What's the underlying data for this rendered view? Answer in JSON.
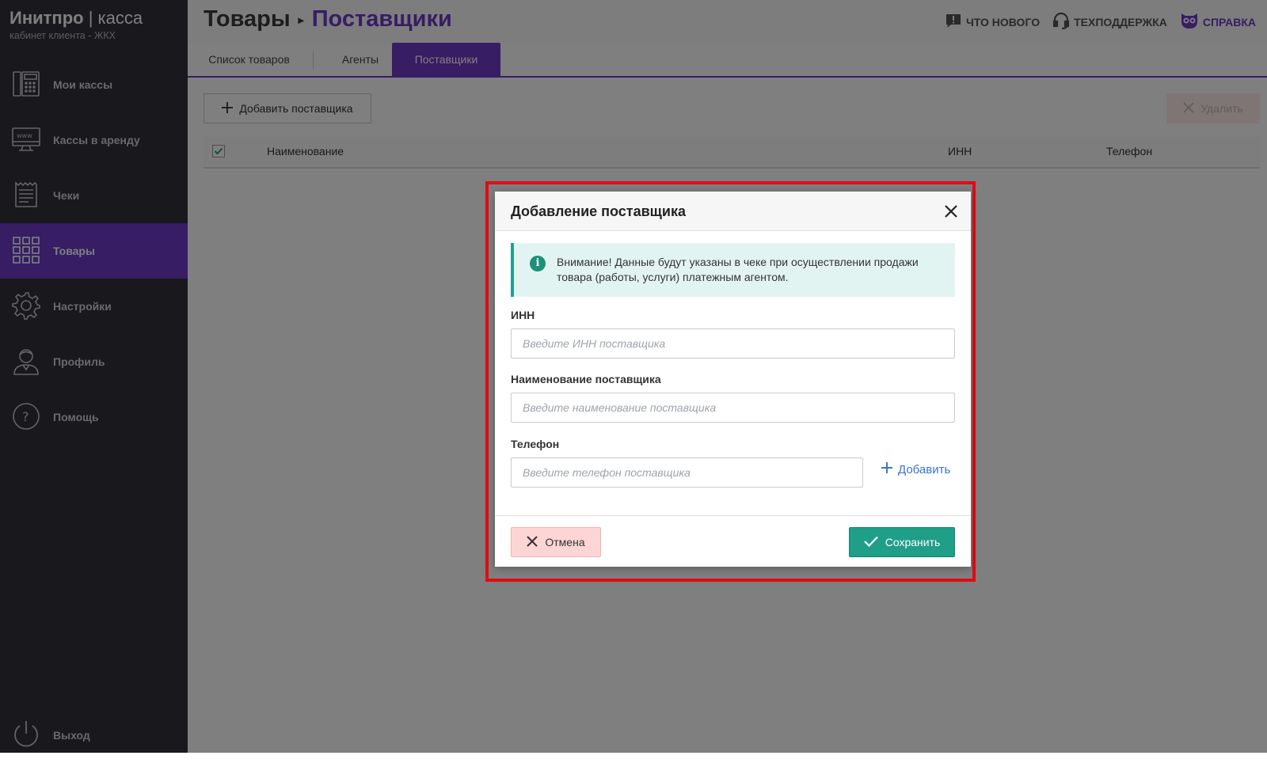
{
  "brand": {
    "name": "Инитпро",
    "separator": "|",
    "product": "касса",
    "subtitle": "кабинет клиента - ЖКХ"
  },
  "sidebar": {
    "items": [
      {
        "label": "Мои кассы",
        "icon": "cash-register-icon"
      },
      {
        "label": "Кассы в аренду",
        "icon": "monitor-www-icon"
      },
      {
        "label": "Чеки",
        "icon": "receipt-icon"
      },
      {
        "label": "Товары",
        "icon": "grid-icon",
        "active": true
      },
      {
        "label": "Настройки",
        "icon": "gear-icon"
      },
      {
        "label": "Профиль",
        "icon": "user-icon"
      },
      {
        "label": "Помощь",
        "icon": "help-icon"
      }
    ],
    "logout": {
      "label": "Выход",
      "icon": "power-icon"
    }
  },
  "header": {
    "breadcrumb": {
      "parent": "Товары",
      "separator": "▸",
      "current": "Поставщики"
    },
    "links": {
      "whats_new": "ЧТО НОВОГО",
      "support": "ТЕХПОДДЕРЖКА",
      "help": "СПРАВКА"
    }
  },
  "tabs": [
    {
      "label": "Список товаров"
    },
    {
      "label": "Агенты"
    },
    {
      "label": "Поставщики",
      "active": true
    }
  ],
  "toolbar": {
    "add_label": "Добавить поставщика",
    "delete_label": "Удалить"
  },
  "table": {
    "columns": [
      "Наименование",
      "ИНН",
      "Телефон"
    ],
    "select_all_checked": true
  },
  "modal": {
    "title": "Добавление поставщика",
    "alert": "Внимание! Данные будут указаны в чеке при осуществлении продажи товара (работы, услуги) платежным агентом.",
    "fields": {
      "inn": {
        "label": "ИНН",
        "placeholder": "Введите ИНН поставщика",
        "value": ""
      },
      "name": {
        "label": "Наименование поставщика",
        "placeholder": "Введите наименование поставщика",
        "value": ""
      },
      "phone": {
        "label": "Телефон",
        "placeholder": "Введите телефон поставщика",
        "value": ""
      }
    },
    "add_phone_label": "Добавить",
    "cancel_label": "Отмена",
    "save_label": "Сохранить"
  },
  "colors": {
    "sidebar_bg": "#32323a",
    "accent": "#6d3bc8",
    "save": "#1f9e88",
    "cancel": "#fdd5d5",
    "highlight_border": "#e20b12",
    "alert_bg": "#e2f4f1"
  }
}
